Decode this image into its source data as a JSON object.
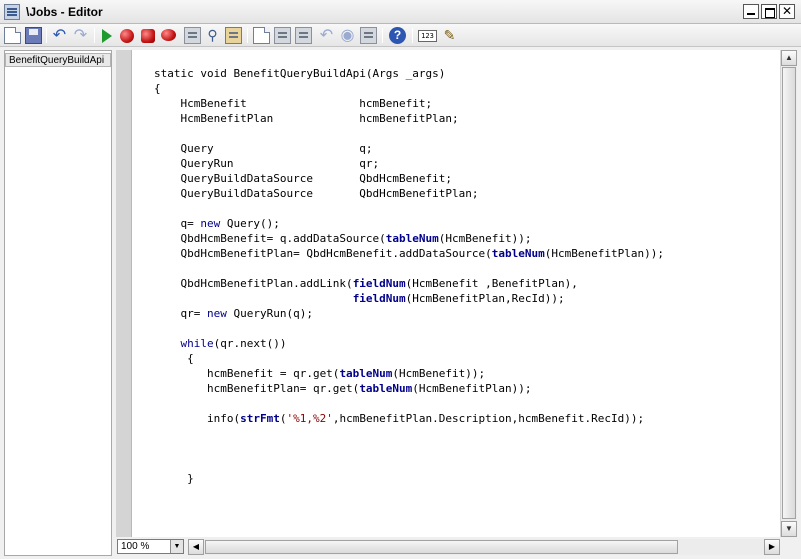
{
  "window": {
    "title": "\\Jobs - Editor",
    "close_glyph": "✕"
  },
  "toolbar": {
    "buttons": [
      {
        "name": "new-icon"
      },
      {
        "name": "save-icon"
      },
      {
        "name": "undo-icon"
      },
      {
        "name": "redo-icon"
      },
      {
        "name": "run-icon"
      },
      {
        "name": "breakpoint-icon"
      },
      {
        "name": "remove-breakpoints-icon"
      },
      {
        "name": "enable-breakpoint-icon"
      },
      {
        "name": "compile-icon"
      },
      {
        "name": "lookup-icon"
      },
      {
        "name": "script-icon"
      },
      {
        "name": "list-tables-icon"
      },
      {
        "name": "list-classes-icon"
      },
      {
        "name": "list-types-icon"
      },
      {
        "name": "undo-edit-icon"
      },
      {
        "name": "go-icon"
      },
      {
        "name": "source-code-icon"
      },
      {
        "name": "help-icon"
      },
      {
        "name": "line-number-icon"
      },
      {
        "name": "edit-icon"
      }
    ],
    "help_glyph": "?",
    "line_number_label": "123"
  },
  "sidebar": {
    "items": [
      {
        "label": "BenefitQueryBuildApi"
      }
    ]
  },
  "editor": {
    "code": [
      [
        {
          "t": "static void BenefitQueryBuildApi(Args _args)"
        }
      ],
      [
        {
          "t": "{"
        }
      ],
      [
        {
          "t": "    HcmBenefit                 hcmBenefit;"
        }
      ],
      [
        {
          "t": "    HcmBenefitPlan             hcmBenefitPlan;"
        }
      ],
      [
        {
          "t": ""
        }
      ],
      [
        {
          "t": "    Query                      q;"
        }
      ],
      [
        {
          "t": "    QueryRun                   qr;"
        }
      ],
      [
        {
          "t": "    QueryBuildDataSource       QbdHcmBenefit;"
        }
      ],
      [
        {
          "t": "    QueryBuildDataSource       QbdHcmBenefitPlan;"
        }
      ],
      [
        {
          "t": ""
        }
      ],
      [
        {
          "t": "    q= "
        },
        {
          "t": "new",
          "c": "kw"
        },
        {
          "t": " Query();"
        }
      ],
      [
        {
          "t": "    QbdHcmBenefit= q.addDataSource("
        },
        {
          "t": "tableNum",
          "c": "bi"
        },
        {
          "t": "(HcmBenefit));"
        }
      ],
      [
        {
          "t": "    QbdHcmBenefitPlan= QbdHcmBenefit.addDataSource("
        },
        {
          "t": "tableNum",
          "c": "bi"
        },
        {
          "t": "(HcmBenefitPlan));"
        }
      ],
      [
        {
          "t": ""
        }
      ],
      [
        {
          "t": "    QbdHcmBenefitPlan.addLink("
        },
        {
          "t": "fieldNum",
          "c": "bi"
        },
        {
          "t": "(HcmBenefit ,BenefitPlan),"
        }
      ],
      [
        {
          "t": "                              "
        },
        {
          "t": "fieldNum",
          "c": "bi"
        },
        {
          "t": "(HcmBenefitPlan,RecId));"
        }
      ],
      [
        {
          "t": "    qr= "
        },
        {
          "t": "new",
          "c": "kw"
        },
        {
          "t": " QueryRun(q);"
        }
      ],
      [
        {
          "t": ""
        }
      ],
      [
        {
          "t": "    "
        },
        {
          "t": "while",
          "c": "kw"
        },
        {
          "t": "(qr.next())"
        }
      ],
      [
        {
          "t": "     {"
        }
      ],
      [
        {
          "t": "        hcmBenefit = qr.get("
        },
        {
          "t": "tableNum",
          "c": "bi"
        },
        {
          "t": "(HcmBenefit));"
        }
      ],
      [
        {
          "t": "        hcmBenefitPlan= qr.get("
        },
        {
          "t": "tableNum",
          "c": "bi"
        },
        {
          "t": "(HcmBenefitPlan));"
        }
      ],
      [
        {
          "t": ""
        }
      ],
      [
        {
          "t": "        info("
        },
        {
          "t": "strFmt",
          "c": "bi"
        },
        {
          "t": "("
        },
        {
          "t": "'%1,%2'",
          "c": "st"
        },
        {
          "t": ",hcmBenefitPlan.Description,hcmBenefit.RecId));"
        }
      ],
      [
        {
          "t": ""
        }
      ],
      [
        {
          "t": ""
        }
      ],
      [
        {
          "t": ""
        }
      ],
      [
        {
          "t": "     }"
        }
      ]
    ]
  },
  "scroll": {
    "up_glyph": "▲",
    "down_glyph": "▼",
    "left_glyph": "◀",
    "right_glyph": "▶"
  },
  "zoom": {
    "value": "100 %",
    "arrow_glyph": "▼"
  }
}
